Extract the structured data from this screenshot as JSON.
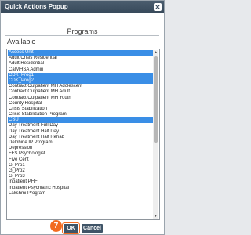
{
  "window": {
    "title": "Quick Actions Popup",
    "close_icon": "close-icon"
  },
  "section": {
    "title": "Programs"
  },
  "available_label": "Available",
  "list": {
    "items": [
      {
        "label": "Access Unit",
        "selected": true
      },
      {
        "label": "Adult Crisis Residential",
        "selected": false
      },
      {
        "label": "Adult Residential",
        "selected": false
      },
      {
        "label": "CalMHSA Admin",
        "selected": false
      },
      {
        "label": "CDK_Prog1",
        "selected": true
      },
      {
        "label": "CDK_Prog2",
        "selected": true
      },
      {
        "label": "Contract Outpatient MH Adolescent",
        "selected": false
      },
      {
        "label": "Contract Outpatient MH Adult",
        "selected": false
      },
      {
        "label": "Contract Outpatient MH Youth",
        "selected": false
      },
      {
        "label": "County Hospital",
        "selected": false
      },
      {
        "label": "Crisis Stabilization",
        "selected": false
      },
      {
        "label": "Crisis Stabilization Program",
        "selected": false
      },
      {
        "label": "CSU",
        "selected": true
      },
      {
        "label": "Day Treatment Full Day",
        "selected": false
      },
      {
        "label": "Day Treatment Half Day",
        "selected": false
      },
      {
        "label": "Day Treatment Half Rehab",
        "selected": false
      },
      {
        "label": "Delphine IP Program",
        "selected": false
      },
      {
        "label": "Depression",
        "selected": false
      },
      {
        "label": "FFS Psychologist",
        "selected": false
      },
      {
        "label": "Five Cent",
        "selected": false
      },
      {
        "label": "G_Pro1",
        "selected": false
      },
      {
        "label": "G_Pro2",
        "selected": false
      },
      {
        "label": "G_Pro3",
        "selected": false
      },
      {
        "label": "Inpatient PHF",
        "selected": false
      },
      {
        "label": "Inpatient Psychiatric Hospital",
        "selected": false
      },
      {
        "label": "Lakshmi Program",
        "selected": false
      }
    ]
  },
  "step_badge": "7",
  "buttons": {
    "ok_label": "OK",
    "cancel_label": "Cancel"
  },
  "colors": {
    "titlebar": "#3f5163",
    "selection": "#3a8ee6",
    "accent": "#f26b20",
    "button": "#3f5467"
  }
}
